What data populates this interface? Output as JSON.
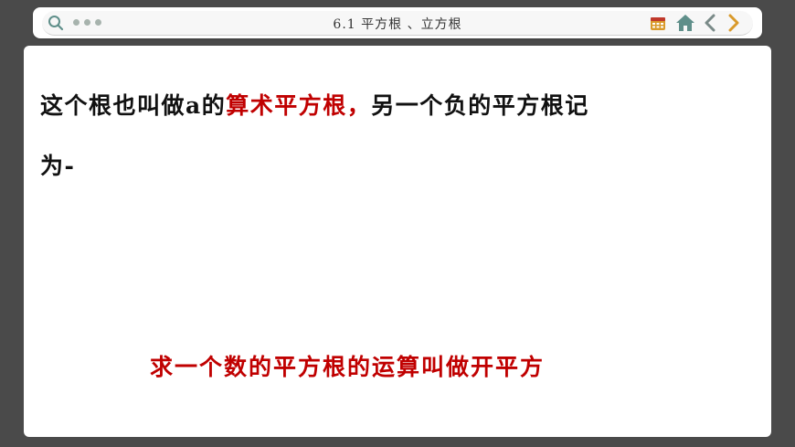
{
  "header": {
    "title": "6.1 平方根 、立方根"
  },
  "icons": {
    "search": "search-icon",
    "menu": "dots-icon",
    "calendar": "calendar-icon",
    "home": "home-icon",
    "prev": "chevron-left-icon",
    "next": "chevron-right-icon"
  },
  "colors": {
    "accent_red": "#c00000",
    "icon_gold": "#d99a2b",
    "icon_teal": "#5f8f8a"
  },
  "content": {
    "line1_prefix": "这个根也叫做a的",
    "line1_highlight": "算术平方根，",
    "line1_suffix": "另一个负的平方根记",
    "line2": "为-",
    "conclusion": "求一个数的平方根的运算叫做开平方"
  }
}
